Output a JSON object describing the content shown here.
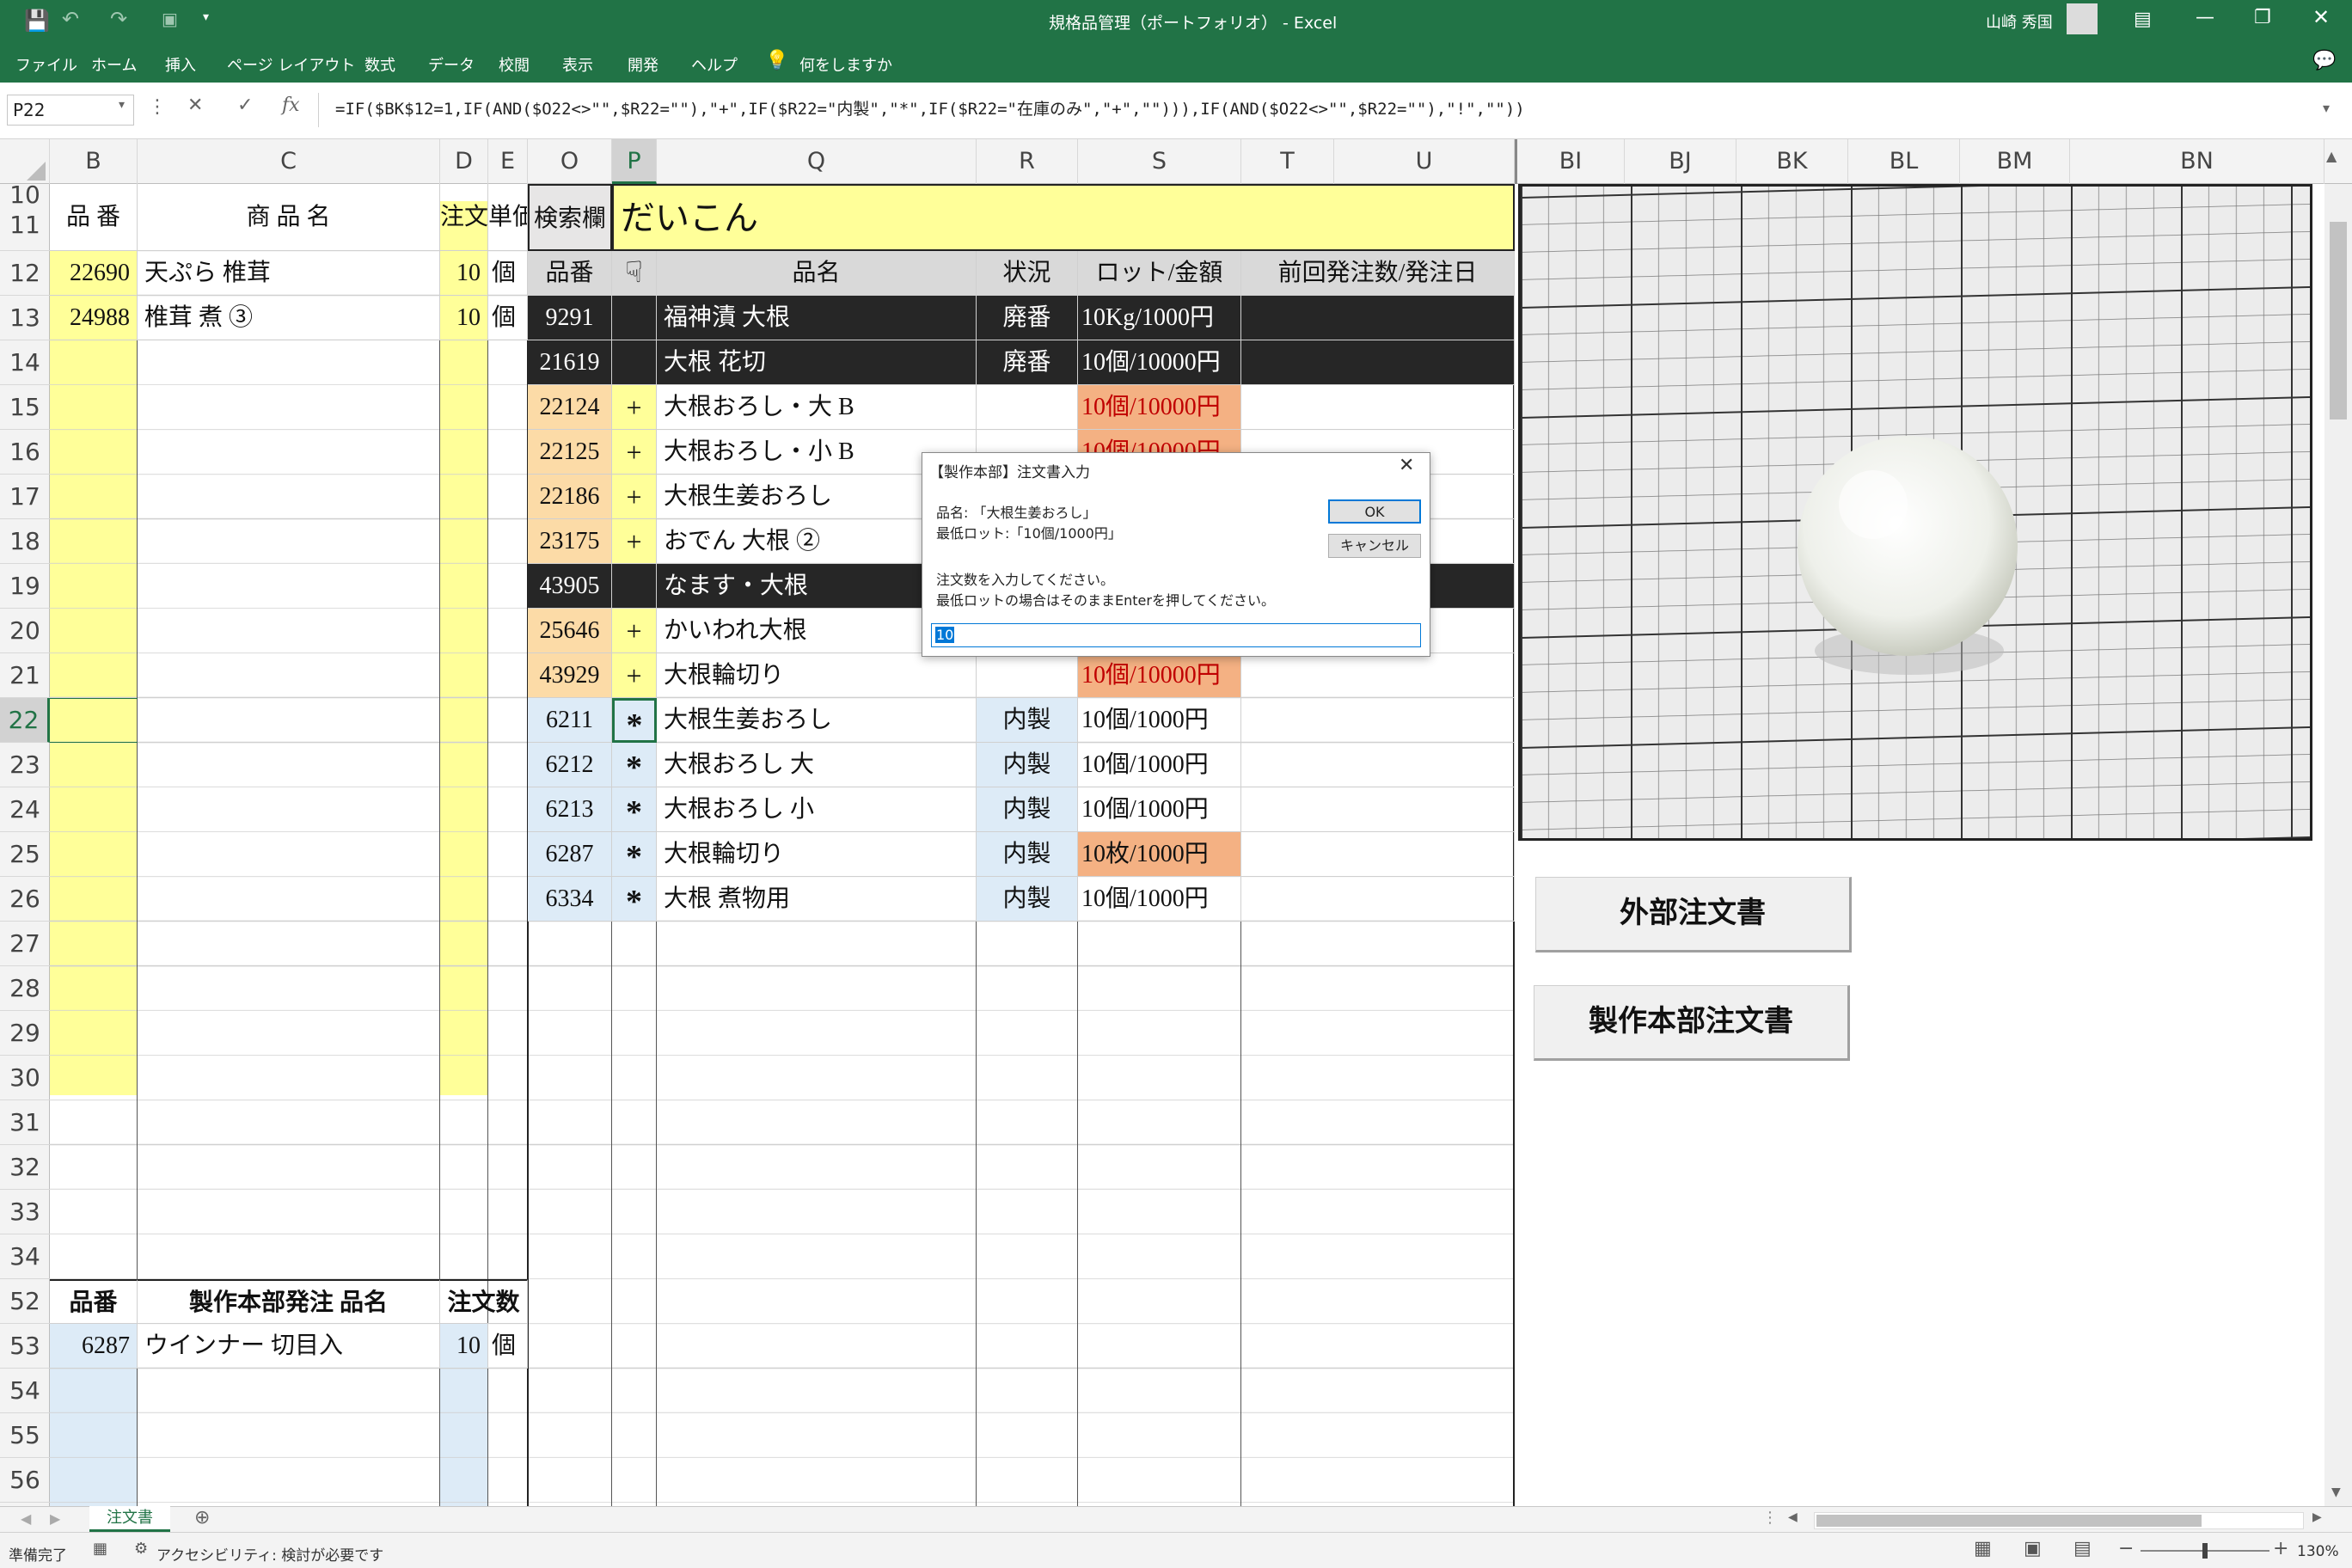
{
  "window": {
    "title": "規格品管理（ポートフォリオ）  -  Excel",
    "user": "山崎 秀国"
  },
  "ribbon_tabs": [
    "ファイル",
    "ホーム",
    "挿入",
    "ページ レイアウト",
    "数式",
    "データ",
    "校閲",
    "表示",
    "開発",
    "ヘルプ",
    "何をしますか"
  ],
  "formula_bar": {
    "name_box": "P22",
    "formula": "=IF($BK$12=1,IF(AND($O22<>\"\",$R22=\"\"),\"+\",IF($R22=\"内製\",\"*\",IF($R22=\"在庫のみ\",\"+\",\"\"))),IF(AND($O22<>\"\",$R22=\"\"),\"!\",\"\"))"
  },
  "column_headers": [
    "B",
    "C",
    "D",
    "E",
    "O",
    "P",
    "Q",
    "R",
    "S",
    "T",
    "U",
    "BI",
    "BJ",
    "BK",
    "BL",
    "BM",
    "BN"
  ],
  "row_headers": [
    "10",
    "11",
    "12",
    "13",
    "14",
    "15",
    "16",
    "17",
    "18",
    "19",
    "20",
    "21",
    "22",
    "23",
    "24",
    "25",
    "26",
    "27",
    "28",
    "29",
    "30",
    "31",
    "32",
    "33",
    "34",
    "52",
    "53",
    "54",
    "55",
    "56"
  ],
  "left_table": {
    "header": {
      "code": "品  番",
      "name": "商  品  名",
      "qty": "注文",
      "unit": "単価"
    },
    "rows": [
      {
        "code": "22690",
        "name": "天ぷら 椎茸",
        "qty": "10",
        "unit": "個"
      },
      {
        "code": "24988",
        "name": "椎茸 煮 ③",
        "qty": "10",
        "unit": "個"
      }
    ],
    "section2_header": {
      "code": "品番",
      "name": "製作本部発注  品名",
      "qty": "注文数"
    },
    "section2_rows": [
      {
        "code": "6287",
        "name": "ウインナー  切目入",
        "qty": "10",
        "unit": "個"
      }
    ]
  },
  "search": {
    "label": "検索欄",
    "value": "だいこん"
  },
  "right_table": {
    "header": {
      "code": "品番",
      "p": "",
      "name": "品名",
      "status": "状況",
      "lot": "ロット/金額",
      "prev": "前回発注数/発注日"
    },
    "rows": [
      {
        "code": "9291",
        "mark": "",
        "name": "福神漬 大根",
        "status": "廃番",
        "lot": "10Kg/1000円",
        "style": "dark"
      },
      {
        "code": "21619",
        "mark": "",
        "name": "大根 花切",
        "status": "廃番",
        "lot": "10個/10000円",
        "style": "dark"
      },
      {
        "code": "22124",
        "mark": "+",
        "name": "大根おろし・大 B",
        "status": "",
        "lot": "10個/10000円",
        "style": "peach"
      },
      {
        "code": "22125",
        "mark": "+",
        "name": "大根おろし・小 B",
        "status": "",
        "lot": "10個/10000円",
        "style": "peach"
      },
      {
        "code": "22186",
        "mark": "+",
        "name": "大根生姜おろし",
        "status": "",
        "lot": "",
        "style": "peach"
      },
      {
        "code": "23175",
        "mark": "+",
        "name": "おでん 大根 ②",
        "status": "",
        "lot": "",
        "style": "peach"
      },
      {
        "code": "43905",
        "mark": "",
        "name": "なます・大根",
        "status": "",
        "lot": "",
        "style": "dark"
      },
      {
        "code": "25646",
        "mark": "+",
        "name": "かいわれ大根",
        "status": "",
        "lot": "",
        "style": "peach"
      },
      {
        "code": "43929",
        "mark": "+",
        "name": "大根輪切り",
        "status": "",
        "lot": "10個/10000円",
        "style": "peach"
      },
      {
        "code": "6211",
        "mark": "*",
        "name": "大根生姜おろし",
        "status": "内製",
        "lot": "10個/1000円",
        "style": "blue"
      },
      {
        "code": "6212",
        "mark": "*",
        "name": "大根おろし 大",
        "status": "内製",
        "lot": "10個/1000円",
        "style": "blue"
      },
      {
        "code": "6213",
        "mark": "*",
        "name": "大根おろし 小",
        "status": "内製",
        "lot": "10個/1000円",
        "style": "blue"
      },
      {
        "code": "6287",
        "mark": "*",
        "name": "大根輪切り",
        "status": "内製",
        "lot": "10枚/1000円",
        "style": "blue-orange"
      },
      {
        "code": "6334",
        "mark": "*",
        "name": "大根 煮物用",
        "status": "内製",
        "lot": "10個/1000円",
        "style": "blue"
      }
    ]
  },
  "dialog": {
    "title": "【製作本部】注文書入力",
    "line1": "品名: 「大根生姜おろし」",
    "line2": "最低ロット:「10個/1000円」",
    "line3": "注文数を入力してください。",
    "line4": " 最低ロットの場合はそのままEnterを押してください。",
    "input_value": "10",
    "ok_label": "OK",
    "cancel_label": "キャンセル"
  },
  "buttons": {
    "external": "外部注文書",
    "internal": "製作本部注文書"
  },
  "sheet_tab": "注文書",
  "status": {
    "ready": "準備完了",
    "accessibility": "アクセシビリティ: 検討が必要です",
    "zoom": "130%"
  },
  "colors": {
    "excel_green": "#217346",
    "yellow": "#ffff99",
    "orange": "#f4b183",
    "peach": "#fcdba7",
    "blue": "#ddebf7",
    "dark": "#262626"
  }
}
